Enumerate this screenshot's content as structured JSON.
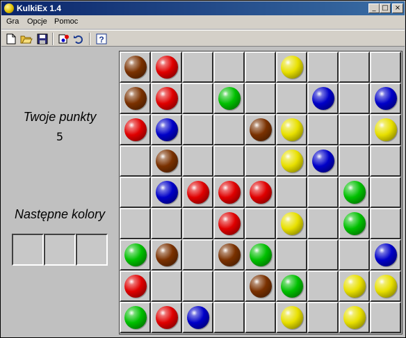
{
  "window": {
    "title": "KulkiEx 1.4"
  },
  "titlebar_buttons": {
    "minimize": "_",
    "maximize": "□",
    "close": "×"
  },
  "menu": {
    "items": [
      "Gra",
      "Opcje",
      "Pomoc"
    ]
  },
  "toolbar": {
    "icons": [
      "new-icon",
      "open-icon",
      "save-icon",
      "hint-icon",
      "undo-icon",
      "help-icon"
    ],
    "help_glyph": "?"
  },
  "score": {
    "label": "Twoje punkty",
    "value": "5"
  },
  "next": {
    "label": "Następne kolory",
    "colors": [
      "",
      "",
      ""
    ]
  },
  "colors": {
    "brown": "#7a3100",
    "red": "#e00000",
    "green": "#00c000",
    "blue": "#0000c8",
    "yellow": "#e8e000"
  },
  "board": [
    [
      "brown",
      "red",
      "",
      "",
      "",
      "yellow",
      "",
      "",
      ""
    ],
    [
      "brown",
      "red",
      "",
      "green",
      "",
      "",
      "blue",
      "",
      "blue"
    ],
    [
      "red",
      "blue",
      "",
      "",
      "brown",
      "yellow",
      "",
      "",
      "yellow"
    ],
    [
      "",
      "brown",
      "",
      "",
      "",
      "yellow",
      "blue",
      "",
      ""
    ],
    [
      "",
      "blue",
      "red",
      "red",
      "red",
      "",
      "",
      "green",
      ""
    ],
    [
      "",
      "",
      "",
      "red",
      "",
      "yellow",
      "",
      "green",
      ""
    ],
    [
      "green",
      "brown",
      "",
      "brown",
      "green",
      "",
      "",
      "",
      "blue"
    ],
    [
      "red",
      "",
      "",
      "",
      "brown",
      "green",
      "",
      "yellow",
      "yellow"
    ],
    [
      "green",
      "red",
      "blue",
      "",
      "",
      "yellow",
      "",
      "yellow",
      ""
    ]
  ]
}
